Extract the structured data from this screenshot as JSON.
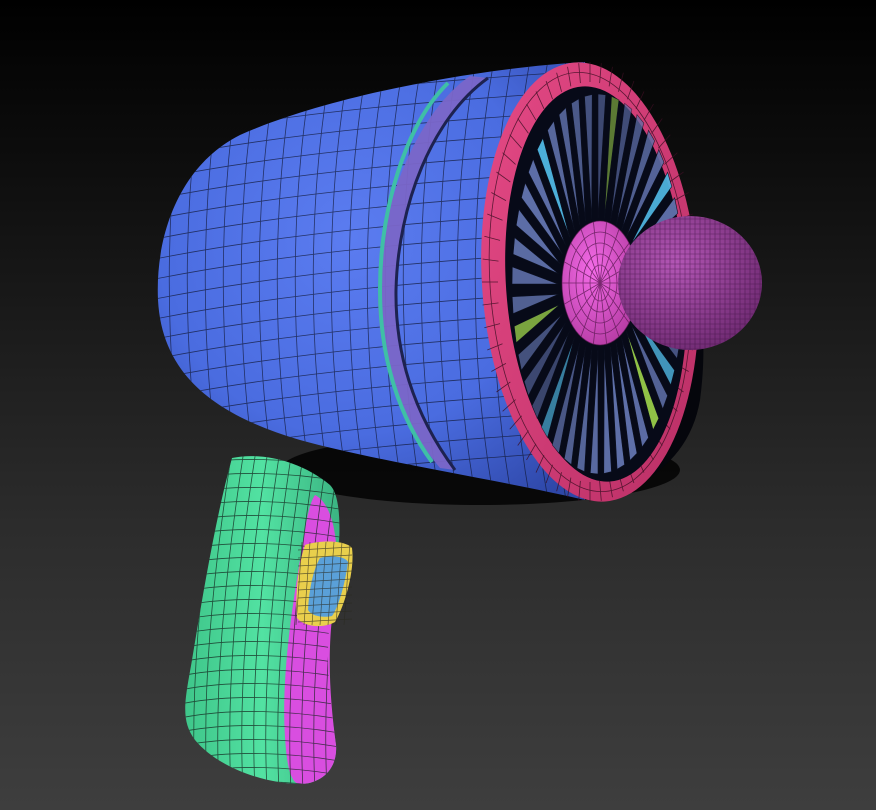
{
  "scene": {
    "subject": "blaster-model-icon",
    "colors": {
      "background_top": "#000000",
      "background_bottom": "#3e3e3e",
      "body_blue": "#4a6ce0",
      "ring_groove": "#7a66c8",
      "teal_line": "#3fbfa6",
      "intake_ring": "#d93a78",
      "fan_blade": "#5e6fa8",
      "hub_magenta": "#e04fd6",
      "dome_purple": "#9a3e9c",
      "grip_green": "#4fdc9e",
      "grip_magenta": "#d94ee0",
      "trigger_yellow": "#e9cf4c",
      "trigger_blue": "#5aa0d8",
      "wire_line": "#1a1a2e"
    },
    "fan_blade_count": 40
  }
}
